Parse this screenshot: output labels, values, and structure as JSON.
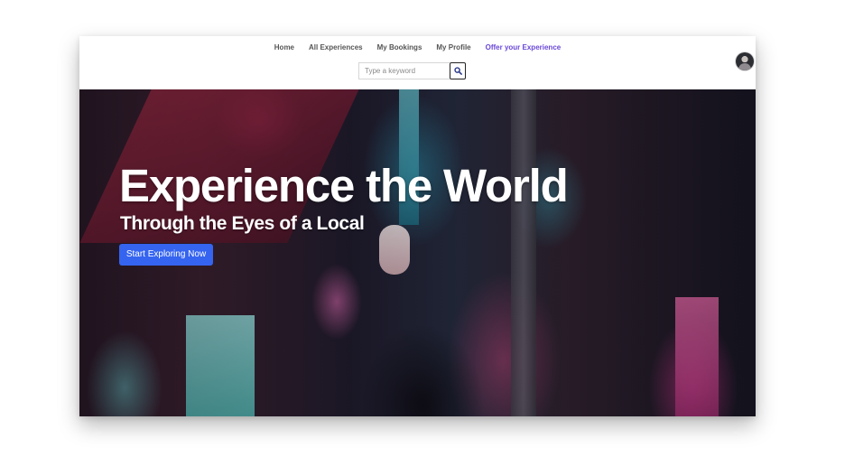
{
  "nav": {
    "items": [
      {
        "label": "Home"
      },
      {
        "label": "All Experiences"
      },
      {
        "label": "My Bookings"
      },
      {
        "label": "My Profile"
      },
      {
        "label": "Offer your Experience",
        "accent": true
      }
    ]
  },
  "search": {
    "placeholder": "Type a keyword",
    "icon": "search-icon"
  },
  "hero": {
    "title": "Experience the World",
    "subtitle": "Through the Eyes of a Local",
    "cta_label": "Start Exploring Now",
    "background": "night-street-neon-photo"
  },
  "user": {
    "avatar": "avatar-icon"
  },
  "colors": {
    "accent": "#6a47d6",
    "cta": "#3564f0",
    "nav_text": "#555555"
  }
}
